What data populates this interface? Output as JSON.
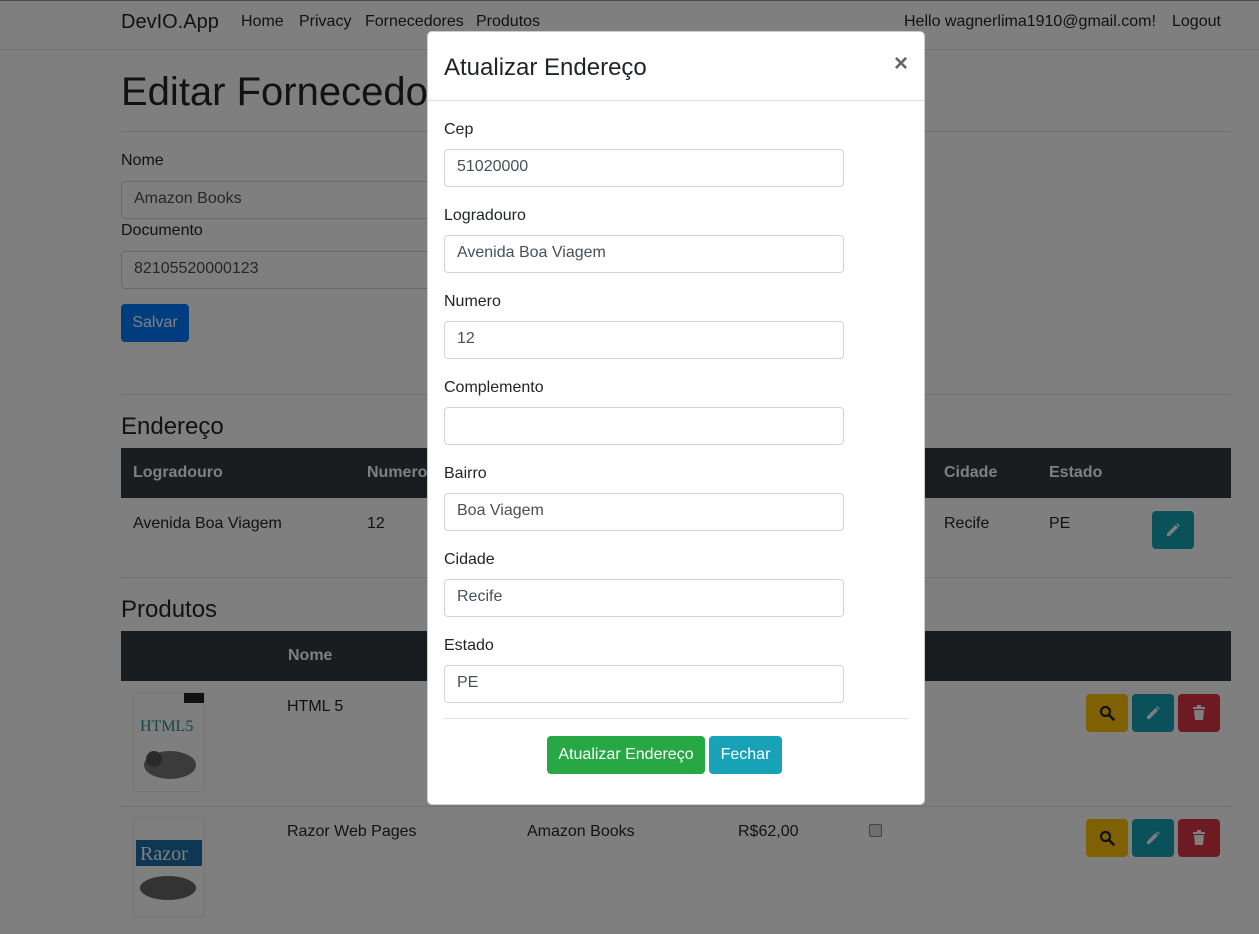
{
  "navbar": {
    "brand": "DevIO.App",
    "links": [
      "Home",
      "Privacy",
      "Fornecedores",
      "Produtos"
    ],
    "greeting": "Hello wagnerlima1910@gmail.com!",
    "logout": "Logout"
  },
  "page": {
    "title": "Editar Fornecedor",
    "nome_label": "Nome",
    "nome_value": "Amazon Books",
    "documento_label": "Documento",
    "documento_value": "82105520000123",
    "save_label": "Salvar"
  },
  "endereco": {
    "heading": "Endereço",
    "columns": [
      "Logradouro",
      "Numero",
      "Cidade",
      "Estado"
    ],
    "row": {
      "logradouro": "Avenida Boa Viagem",
      "numero": "12",
      "cidade": "Recife",
      "estado": "PE"
    }
  },
  "produtos": {
    "heading": "Produtos",
    "columns": [
      "Nome"
    ],
    "rows": [
      {
        "nome": "HTML 5",
        "fornecedor": "",
        "valor": "",
        "thumb_text": "HTML5"
      },
      {
        "nome": "Razor Web Pages",
        "fornecedor": "Amazon Books",
        "valor": "R$62,00",
        "thumb_text": "Razor"
      }
    ]
  },
  "modal": {
    "title": "Atualizar Endereço",
    "close": "×",
    "fields": [
      {
        "label": "Cep",
        "value": "51020000"
      },
      {
        "label": "Logradouro",
        "value": "Avenida Boa Viagem"
      },
      {
        "label": "Numero",
        "value": "12"
      },
      {
        "label": "Complemento",
        "value": ""
      },
      {
        "label": "Bairro",
        "value": "Boa Viagem"
      },
      {
        "label": "Cidade",
        "value": "Recife"
      },
      {
        "label": "Estado",
        "value": "PE"
      }
    ],
    "submit_label": "Atualizar Endereço",
    "close_label": "Fechar"
  },
  "colors": {
    "primary": "#007bff",
    "success": "#28a745",
    "info": "#17a2b8",
    "warning": "#ffc107",
    "danger": "#dc3545",
    "dark": "#343a40"
  }
}
